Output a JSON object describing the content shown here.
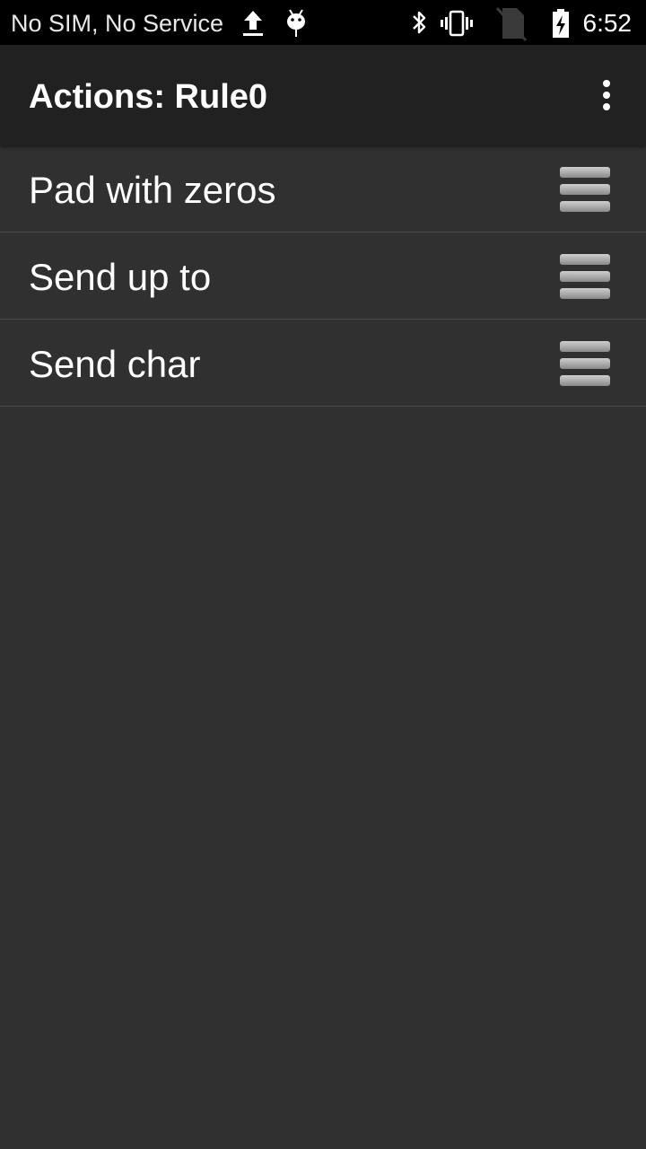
{
  "status_bar": {
    "carrier_text": "No SIM, No Service",
    "time": "6:52",
    "icons": [
      "upload-icon",
      "android-debug-icon",
      "bluetooth-icon",
      "vibrate-icon",
      "no-sim-icon",
      "battery-charging-icon"
    ]
  },
  "app_bar": {
    "title": "Actions: Rule0",
    "menu_icon": "overflow-menu-icon"
  },
  "actions": [
    {
      "label": "Pad with zeros",
      "handle_icon": "drag-handle-icon"
    },
    {
      "label": "Send up to",
      "handle_icon": "drag-handle-icon"
    },
    {
      "label": "Send char",
      "handle_icon": "drag-handle-icon"
    }
  ],
  "colors": {
    "status_bar_bg": "#000000",
    "app_bar_bg": "#212121",
    "content_bg": "#303030",
    "divider": "#4a4a4a",
    "text_primary": "#ffffff"
  }
}
